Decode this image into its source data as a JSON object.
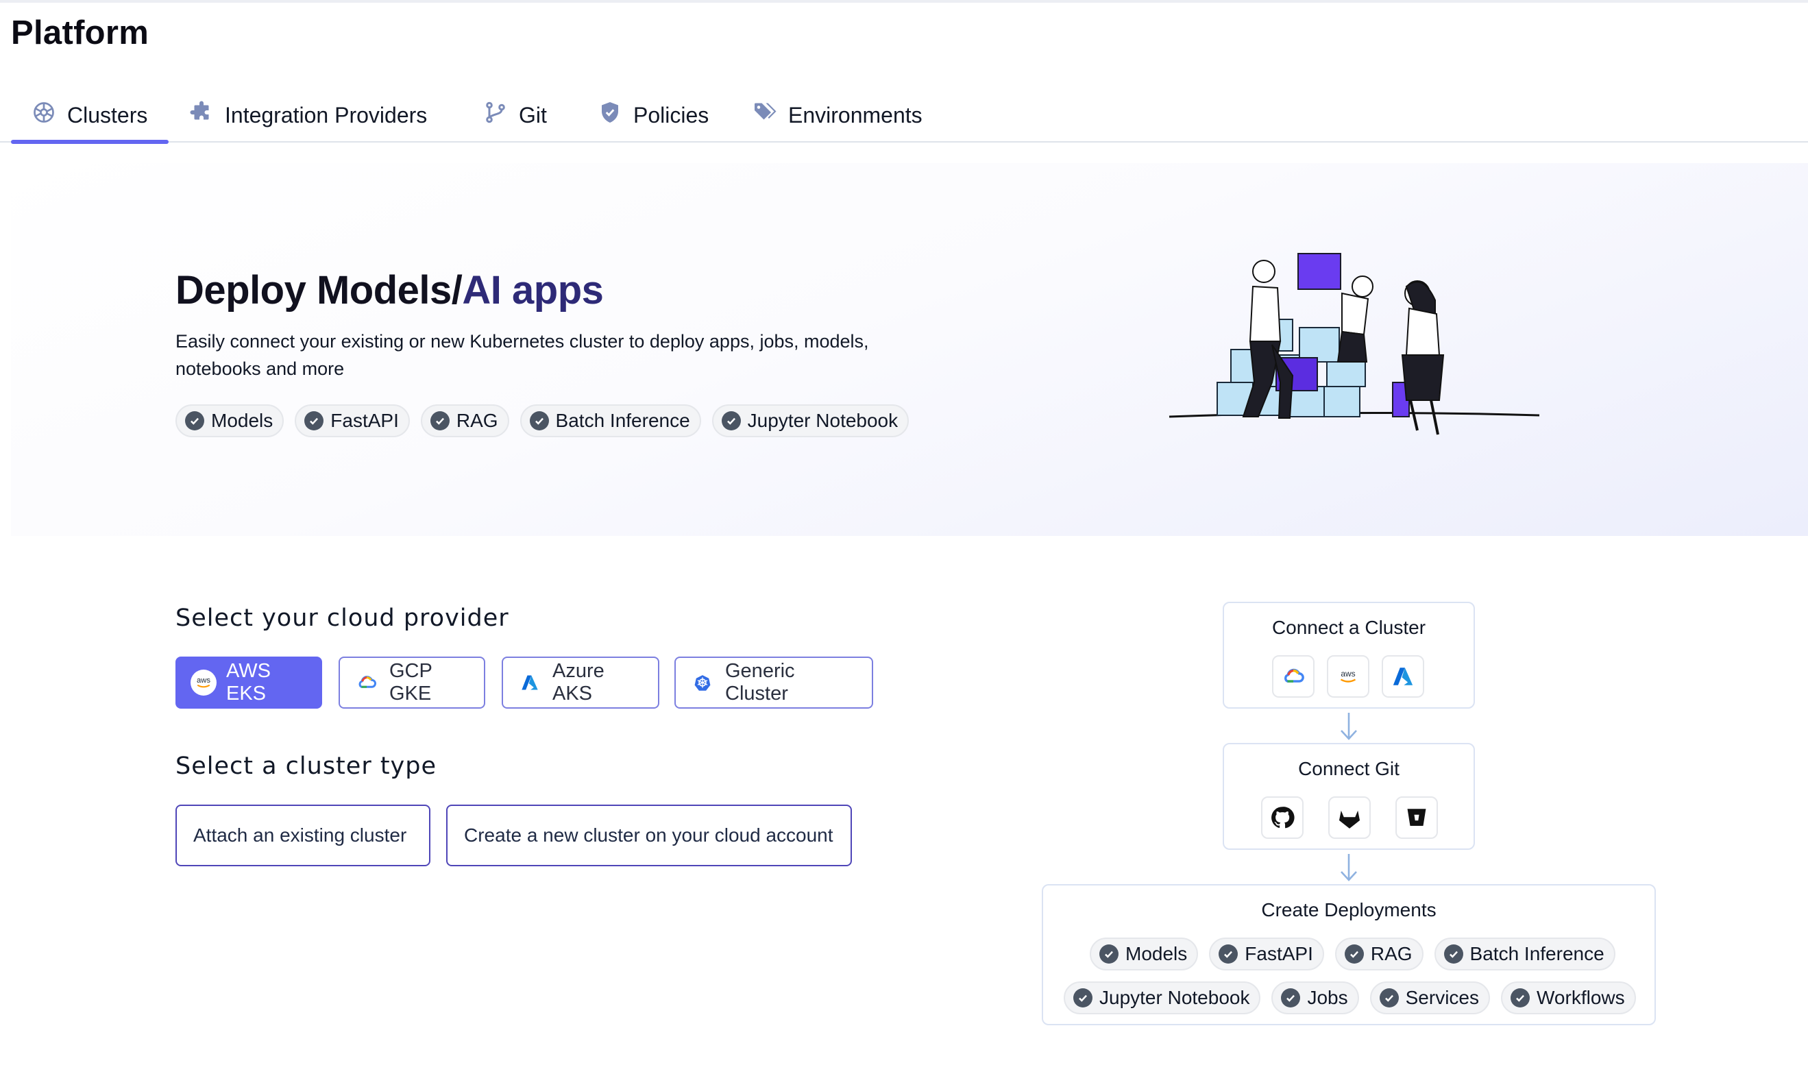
{
  "page": {
    "title": "Platform"
  },
  "tabs": [
    {
      "label": "Clusters",
      "icon": "kubernetes-wheel-icon",
      "active": true
    },
    {
      "label": "Integration Providers",
      "icon": "puzzle-icon",
      "active": false
    },
    {
      "label": "Git",
      "icon": "git-branch-icon",
      "active": false
    },
    {
      "label": "Policies",
      "icon": "shield-icon",
      "active": false
    },
    {
      "label": "Environments",
      "icon": "tags-icon",
      "active": false
    }
  ],
  "hero": {
    "title_part1": "Deploy Models/",
    "title_part2": "AI apps",
    "description": "Easily connect your existing or new Kubernetes cluster to deploy apps, jobs, models, notebooks and more",
    "chips": [
      "Models",
      "FastAPI",
      "RAG",
      "Batch Inference",
      "Jupyter Notebook"
    ]
  },
  "cloud_provider": {
    "title": "Select your cloud provider",
    "options": [
      {
        "label": "AWS EKS",
        "icon": "aws-icon",
        "selected": true
      },
      {
        "label": "GCP GKE",
        "icon": "google-cloud-icon",
        "selected": false
      },
      {
        "label": "Azure AKS",
        "icon": "azure-icon",
        "selected": false
      },
      {
        "label": "Generic Cluster",
        "icon": "kubernetes-icon",
        "selected": false
      }
    ]
  },
  "cluster_type": {
    "title": "Select a cluster type",
    "options": [
      "Attach an existing cluster",
      "Create a new cluster on your cloud account"
    ]
  },
  "flow": {
    "connect_cluster": {
      "title": "Connect a Cluster",
      "icons": [
        "google-cloud-icon",
        "aws-icon",
        "azure-icon"
      ]
    },
    "connect_git": {
      "title": "Connect Git",
      "icons": [
        "github-icon",
        "gitlab-icon",
        "bitbucket-icon"
      ]
    },
    "create_deployments": {
      "title": "Create Deployments",
      "row1": [
        "Models",
        "FastAPI",
        "RAG",
        "Batch Inference"
      ],
      "row2": [
        "Jupyter Notebook",
        "Jobs",
        "Services",
        "Workflows"
      ]
    }
  },
  "colors": {
    "accent": "#6366f1",
    "chip_check": "#4b5563",
    "deep_purple": "#2e2a77"
  }
}
